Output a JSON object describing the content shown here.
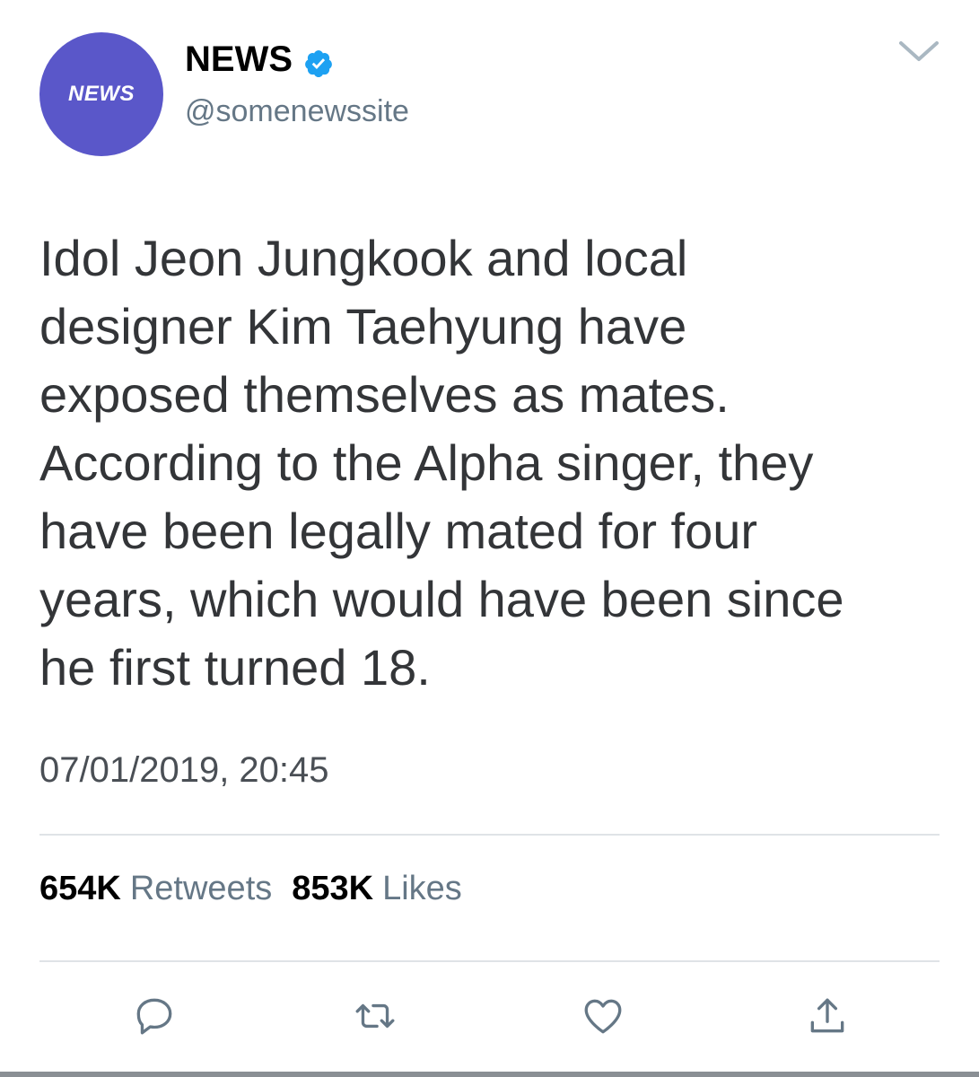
{
  "user": {
    "avatar_text": "NEWS",
    "display_name": "NEWS",
    "handle": "@somenewssite",
    "verified": true,
    "avatar_color": "#5a57c9"
  },
  "tweet": {
    "text": "Idol Jeon Jungkook and local\ndesigner Kim Taehyung have\nexposed themselves as mates.\nAccording to the Alpha singer, they\nhave been legally mated for four\nyears, which would have been since\nhe first turned 18.",
    "timestamp": "07/01/2019, 20:45"
  },
  "stats": {
    "retweets_count": "654K",
    "retweets_label": "Retweets",
    "likes_count": "853K",
    "likes_label": "Likes"
  },
  "actions": {
    "reply_icon": "reply-icon",
    "retweet_icon": "retweet-icon",
    "like_icon": "heart-icon",
    "share_icon": "share-icon"
  },
  "colors": {
    "verified_blue": "#1da1f2",
    "secondary_text": "#657786",
    "icon_gray": "#657786"
  }
}
